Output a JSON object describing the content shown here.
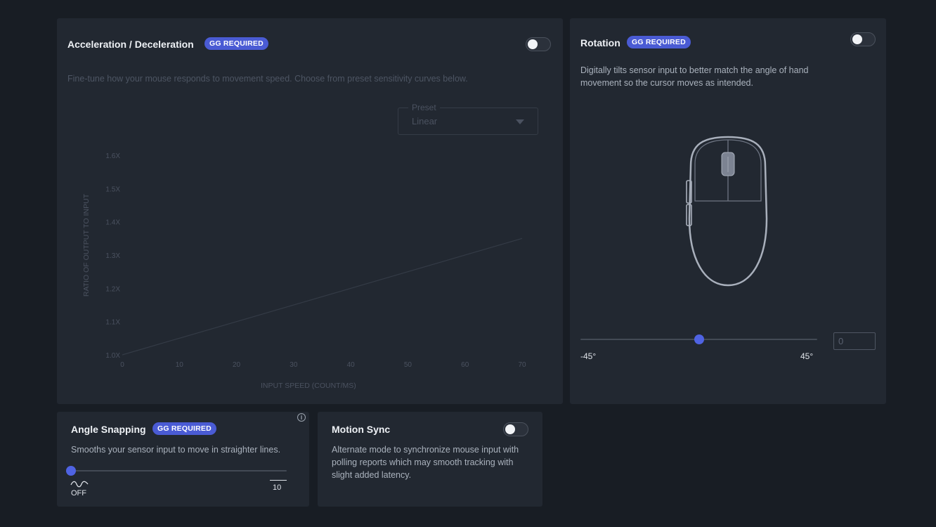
{
  "accel": {
    "title": "Acceleration / Deceleration",
    "badge": "GG REQUIRED",
    "description": "Fine-tune how your mouse responds to movement speed. Choose from preset sensitivity curves below.",
    "preset_label": "Preset",
    "preset_value": "Linear",
    "toggle_on": false
  },
  "chart_data": {
    "type": "line",
    "xlabel": "INPUT SPEED (COUNT/MS)",
    "ylabel": "RATIO OF OUTPUT TO INPUT",
    "xticks": [
      "0",
      "10",
      "20",
      "30",
      "40",
      "50",
      "60",
      "70"
    ],
    "yticks": [
      "1.0X",
      "1.1X",
      "1.2X",
      "1.3X",
      "1.4X",
      "1.5X",
      "1.6X"
    ],
    "xlim": [
      0,
      70
    ],
    "ylim": [
      1.0,
      1.6
    ],
    "series": [
      {
        "x": [
          0,
          70
        ],
        "y": [
          1.0,
          1.35
        ]
      }
    ]
  },
  "rotation": {
    "title": "Rotation",
    "badge": "GG REQUIRED",
    "description": "Digitally tilts sensor input to better match the angle of hand movement so the cursor moves as intended.",
    "min_label": "-45°",
    "max_label": "45°",
    "value": "0",
    "level": 0.5,
    "toggle_on": false
  },
  "angle": {
    "title": "Angle Snapping",
    "badge": "GG REQUIRED",
    "description": "Smooths your sensor input to move in straighter lines.",
    "min_label": "OFF",
    "max_label": "10",
    "level": 0
  },
  "motion": {
    "title": "Motion Sync",
    "description": "Alternate mode to synchronize mouse input with polling reports which may smooth tracking with slight added latency.",
    "toggle_on": false
  }
}
